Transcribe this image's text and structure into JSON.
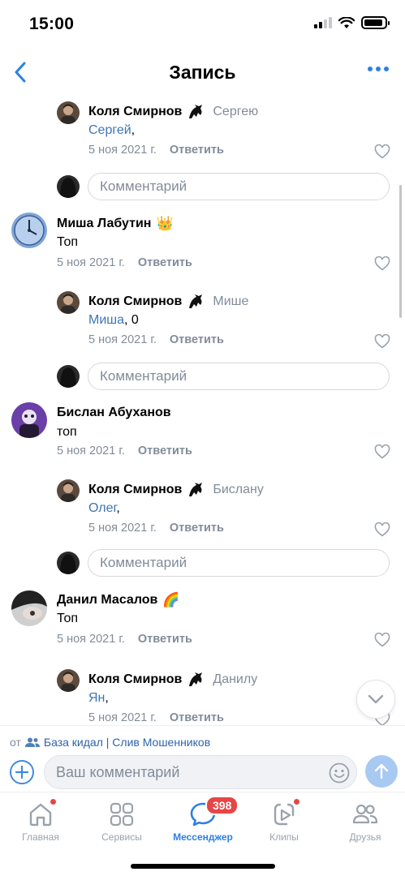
{
  "status_bar": {
    "time": "15:00",
    "battery_level": 0.9
  },
  "nav": {
    "title": "Запись"
  },
  "comments": [
    {
      "author": "Коля Смирнов",
      "reply_to": "Сергею",
      "mention": "Сергей",
      "text": ",",
      "date": "5 ноя 2021 г.",
      "reply_label": "Ответить"
    },
    {
      "placeholder": "Комментарий"
    },
    {
      "author": "Миша Лабутин",
      "emoji": "👑",
      "text": "Топ",
      "date": "5 ноя 2021 г.",
      "reply_label": "Ответить"
    },
    {
      "author": "Коля Смирнов",
      "reply_to": "Мише",
      "mention": "Миша",
      "text": ", 0",
      "date": "5 ноя 2021 г.",
      "reply_label": "Ответить"
    },
    {
      "placeholder": "Комментарий"
    },
    {
      "author": "Бислан Абуханов",
      "text": "топ",
      "date": "5 ноя 2021 г.",
      "reply_label": "Ответить"
    },
    {
      "author": "Коля Смирнов",
      "reply_to": "Бислану",
      "mention": "Олег",
      "text": ",",
      "date": "5 ноя 2021 г.",
      "reply_label": "Ответить"
    },
    {
      "placeholder": "Комментарий"
    },
    {
      "author": "Данил Масалов",
      "emoji": "🌈",
      "text": "Топ",
      "date": "5 ноя 2021 г.",
      "reply_label": "Ответить"
    },
    {
      "author": "Коля Смирнов",
      "reply_to": "Данилу",
      "mention": "Ян",
      "text": ",",
      "date": "5 ноя 2021 г.",
      "reply_label": "Ответить"
    }
  ],
  "composer": {
    "from_prefix": "от",
    "group_name": "База кидал | Слив Мошенников",
    "placeholder": "Ваш комментарий"
  },
  "tabs": [
    {
      "label": "Главная",
      "icon": "home-icon",
      "dot": true
    },
    {
      "label": "Сервисы",
      "icon": "services-icon"
    },
    {
      "label": "Мессенджер",
      "icon": "messenger-icon",
      "badge": "398",
      "active": true
    },
    {
      "label": "Клипы",
      "icon": "clips-icon",
      "dot": true
    },
    {
      "label": "Друзья",
      "icon": "friends-icon"
    }
  ],
  "colors": {
    "accent": "#2d81e0",
    "secondary_text": "#818c99",
    "mention": "#3f75b3",
    "badge": "#e64646"
  }
}
